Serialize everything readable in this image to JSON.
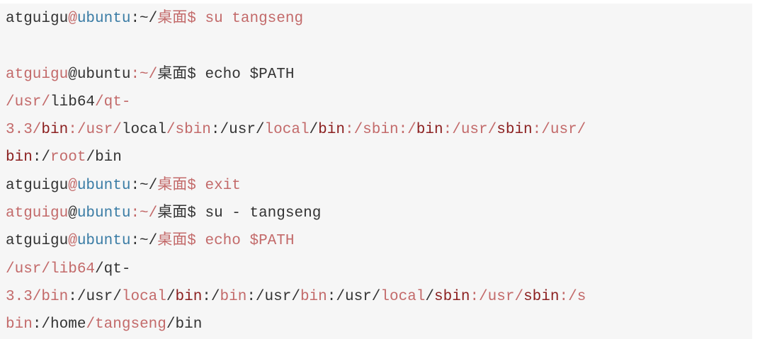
{
  "colors": {
    "background": "#f6f6f6",
    "plain": "#333333",
    "host": "#3a7ca5",
    "path": "#c36a6a",
    "dir": "#8b1f1f"
  },
  "terminal": {
    "lines": [
      [
        {
          "t": "atguigu",
          "c": "plain"
        },
        {
          "t": "@",
          "c": "path"
        },
        {
          "t": "ubuntu",
          "c": "host"
        },
        {
          "t": ":~/",
          "c": "plain"
        },
        {
          "t": "桌面",
          "c": "path"
        },
        {
          "t": "$ su tangseng",
          "c": "path"
        }
      ],
      [],
      [
        {
          "t": "atguigu",
          "c": "path"
        },
        {
          "t": "@",
          "c": "plain"
        },
        {
          "t": "ubuntu",
          "c": "plain"
        },
        {
          "t": ":~/",
          "c": "path"
        },
        {
          "t": "桌面",
          "c": "plain"
        },
        {
          "t": "$ echo $PATH",
          "c": "plain"
        }
      ],
      [
        {
          "t": "/usr/",
          "c": "path"
        },
        {
          "t": "lib64",
          "c": "plain"
        },
        {
          "t": "/qt-",
          "c": "path"
        }
      ],
      [
        {
          "t": "3.3/",
          "c": "path"
        },
        {
          "t": "bin",
          "c": "dir"
        },
        {
          "t": ":/usr/",
          "c": "path"
        },
        {
          "t": "local",
          "c": "plain"
        },
        {
          "t": "/",
          "c": "path"
        },
        {
          "t": "sbin",
          "c": "path"
        },
        {
          "t": ":/usr/",
          "c": "plain"
        },
        {
          "t": "local",
          "c": "path"
        },
        {
          "t": "/",
          "c": "plain"
        },
        {
          "t": "bin",
          "c": "dir"
        },
        {
          "t": ":/sbin:/",
          "c": "path"
        },
        {
          "t": "bin",
          "c": "dir"
        },
        {
          "t": ":/usr/",
          "c": "path"
        },
        {
          "t": "sbin",
          "c": "dir"
        },
        {
          "t": ":/usr/",
          "c": "path"
        }
      ],
      [
        {
          "t": "bin",
          "c": "dir"
        },
        {
          "t": ":/",
          "c": "plain"
        },
        {
          "t": "root",
          "c": "path"
        },
        {
          "t": "/",
          "c": "plain"
        },
        {
          "t": "bin",
          "c": "plain"
        }
      ],
      [
        {
          "t": "atguigu",
          "c": "plain"
        },
        {
          "t": "@",
          "c": "path"
        },
        {
          "t": "ubuntu",
          "c": "host"
        },
        {
          "t": ":~/",
          "c": "plain"
        },
        {
          "t": "桌面",
          "c": "path"
        },
        {
          "t": "$ exit",
          "c": "path"
        }
      ],
      [
        {
          "t": "atguigu",
          "c": "path"
        },
        {
          "t": "@",
          "c": "plain"
        },
        {
          "t": "ubuntu",
          "c": "host"
        },
        {
          "t": ":~/",
          "c": "path"
        },
        {
          "t": "桌面",
          "c": "plain"
        },
        {
          "t": "$ su - tangseng",
          "c": "plain"
        }
      ],
      [
        {
          "t": "atguigu",
          "c": "plain"
        },
        {
          "t": "@",
          "c": "path"
        },
        {
          "t": "ubuntu",
          "c": "host"
        },
        {
          "t": ":~/",
          "c": "plain"
        },
        {
          "t": "桌面",
          "c": "path"
        },
        {
          "t": "$ echo $PATH",
          "c": "path"
        }
      ],
      [
        {
          "t": "/usr/",
          "c": "path"
        },
        {
          "t": "lib64",
          "c": "path"
        },
        {
          "t": "/",
          "c": "plain"
        },
        {
          "t": "qt-",
          "c": "plain"
        }
      ],
      [
        {
          "t": "3.3/",
          "c": "path"
        },
        {
          "t": "bin",
          "c": "path"
        },
        {
          "t": ":/usr/",
          "c": "plain"
        },
        {
          "t": "local",
          "c": "path"
        },
        {
          "t": "/",
          "c": "plain"
        },
        {
          "t": "bin",
          "c": "dir"
        },
        {
          "t": ":/",
          "c": "plain"
        },
        {
          "t": "bin",
          "c": "path"
        },
        {
          "t": ":/usr/",
          "c": "plain"
        },
        {
          "t": "bin",
          "c": "path"
        },
        {
          "t": ":/usr/",
          "c": "plain"
        },
        {
          "t": "local",
          "c": "path"
        },
        {
          "t": "/",
          "c": "plain"
        },
        {
          "t": "sbin",
          "c": "dir"
        },
        {
          "t": ":/usr/",
          "c": "path"
        },
        {
          "t": "sbin",
          "c": "dir"
        },
        {
          "t": ":/s",
          "c": "path"
        }
      ],
      [
        {
          "t": "bin",
          "c": "path"
        },
        {
          "t": ":/",
          "c": "plain"
        },
        {
          "t": "home",
          "c": "plain"
        },
        {
          "t": "/",
          "c": "path"
        },
        {
          "t": "tangseng",
          "c": "path"
        },
        {
          "t": "/",
          "c": "plain"
        },
        {
          "t": "bin",
          "c": "plain"
        }
      ]
    ]
  }
}
